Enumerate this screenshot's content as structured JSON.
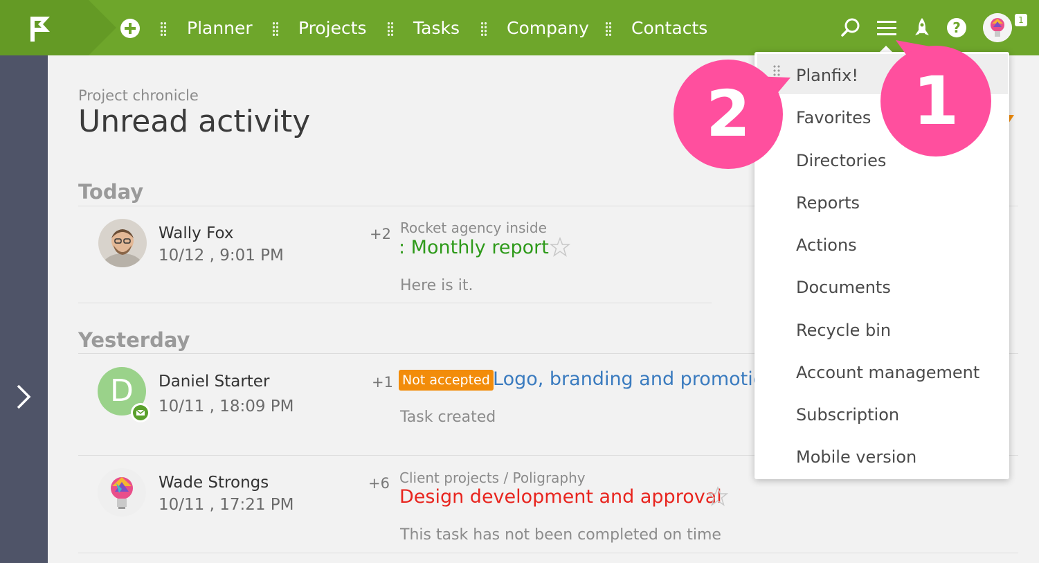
{
  "topbar": {
    "nav": [
      "Planner",
      "Projects",
      "Tasks",
      "Company",
      "Contacts"
    ],
    "notification_count": "1",
    "icons": [
      "logo-flag-icon",
      "add-icon",
      "search-icon",
      "menu-icon",
      "rocket-icon",
      "help-icon",
      "avatar"
    ],
    "color": "#6ea62b"
  },
  "page": {
    "breadcrumb": "Project chronicle",
    "title": "Unread activity"
  },
  "sections": [
    {
      "label": "Today",
      "items": [
        {
          "name": "Wally Fox",
          "date": "10/12 , 9:01 PM",
          "count": "+2",
          "project": "Rocket agency inside",
          "task": ": Monthly report",
          "message": "Here is it."
        }
      ]
    },
    {
      "label": "Yesterday",
      "items": [
        {
          "name": "Daniel Starter",
          "avatar_letter": "D",
          "date": "10/11 , 18:09 PM",
          "count": "+1",
          "badge": "Not accepted",
          "task": "Logo, branding and promotion",
          "message": "Task created"
        },
        {
          "name": "Wade Strongs",
          "date": "10/11 , 17:21 PM",
          "count": "+6",
          "project": "Client projects / Poligraphy",
          "task": "Design development and approval",
          "message": "This task has not been completed on time"
        }
      ]
    }
  ],
  "dropdown": {
    "items": [
      "Planfix!",
      "Favorites",
      "Directories",
      "Reports",
      "Actions",
      "Documents",
      "Recycle bin",
      "Account management",
      "Subscription",
      "Mobile version"
    ]
  },
  "callouts": [
    "1",
    "2"
  ],
  "colors": {
    "green": "#6ea62b",
    "rail": "#4f5468",
    "callout": "#ff4f9e",
    "task_green": "#2e9a1a",
    "task_blue": "#3a7bbf",
    "task_red": "#e8251f",
    "badge_orange": "#f28c0a"
  }
}
